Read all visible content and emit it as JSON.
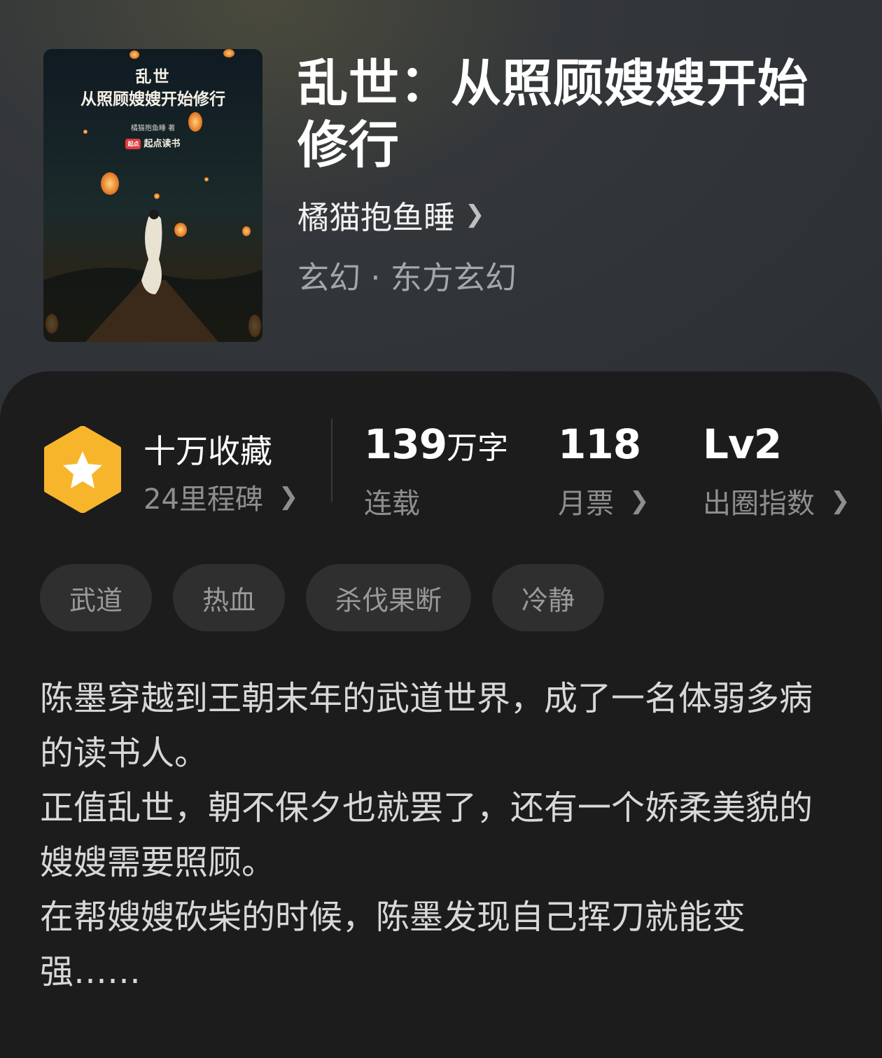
{
  "book": {
    "title": "乱世：从照顾嫂嫂开始修行",
    "author": "橘猫抱鱼睡",
    "genre": "玄幻 · 东方玄幻",
    "cover": {
      "title": "乱世",
      "subtitle": "从照顾嫂嫂开始修行",
      "author_credit": "橘猫抱鱼睡 著",
      "brand_logo": "起点",
      "brand": "起点读书"
    }
  },
  "stats": {
    "collection": {
      "label": "十万收藏",
      "sub": "24里程碑"
    },
    "words": {
      "number": "139",
      "unit": "万字",
      "sub": "连载"
    },
    "tickets": {
      "number": "118",
      "sub": "月票"
    },
    "level": {
      "number": "Lv2",
      "sub": "出圈指数"
    }
  },
  "tags": [
    "武道",
    "热血",
    "杀伐果断",
    "冷静"
  ],
  "description": [
    "陈墨穿越到王朝末年的武道世界，成了一名体弱多病的读书人。",
    "正值乱世，朝不保夕也就罢了，还有一个娇柔美貌的嫂嫂需要照顾。",
    "在帮嫂嫂砍柴的时候，陈墨发现自己挥刀就能变强……"
  ],
  "colors": {
    "badge": "#f7b52c",
    "panel": "#1c1c1c",
    "tag_bg": "#2f2f2f"
  },
  "icons": {
    "chevron": "chevron-right-icon",
    "badge": "star-hexagon-icon"
  }
}
